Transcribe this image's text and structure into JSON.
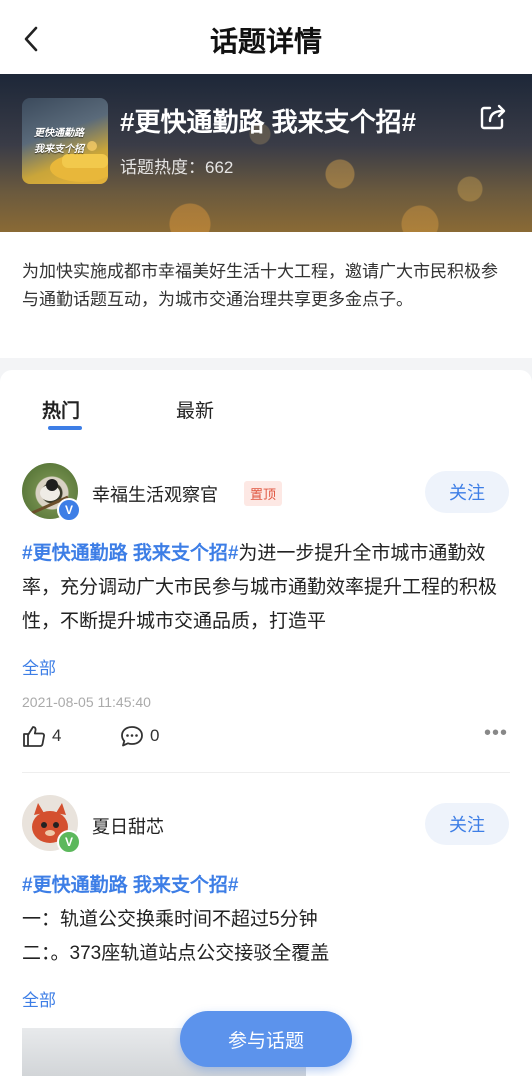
{
  "nav": {
    "title": "话题详情"
  },
  "banner": {
    "thumb_line1": "更快通勤路",
    "thumb_line2": "我来支个招",
    "topic": "#更快通勤路 我来支个招#",
    "heat": "话题热度：662"
  },
  "intro": {
    "text": "为加快实施成都市幸福美好生活十大工程，邀请广大市民积极参与通勤话题互动，为城市交通治理共享更多金点子。"
  },
  "tabs": [
    {
      "label": "热门",
      "active": true
    },
    {
      "label": "最新",
      "active": false
    }
  ],
  "posts": [
    {
      "username": "幸福生活观察官",
      "pinned_label": "置顶",
      "follow_label": "关注",
      "verified": "V",
      "verified_color": "#3d7ee6",
      "tag": "#更快通勤路 我来支个招#",
      "text": "为进一步提升全市城市通勤效率，充分调动广大市民参与城市通勤效率提升工程的积极性，不断提升城市交通品质，打造平",
      "more_label": "全部",
      "time": "2021-08-05 11:45:40",
      "likes": "4",
      "comments": "0"
    },
    {
      "username": "夏日甜芯",
      "follow_label": "关注",
      "verified": "V",
      "verified_color": "#5cb85c",
      "tag": "#更快通勤路 我来支个招#",
      "line1": "一：轨道公交换乘时间不超过5分钟",
      "line2": "二：。373座轨道站点公交接驳全覆盖",
      "more_label": "全部"
    }
  ],
  "join_label": "参与话题"
}
